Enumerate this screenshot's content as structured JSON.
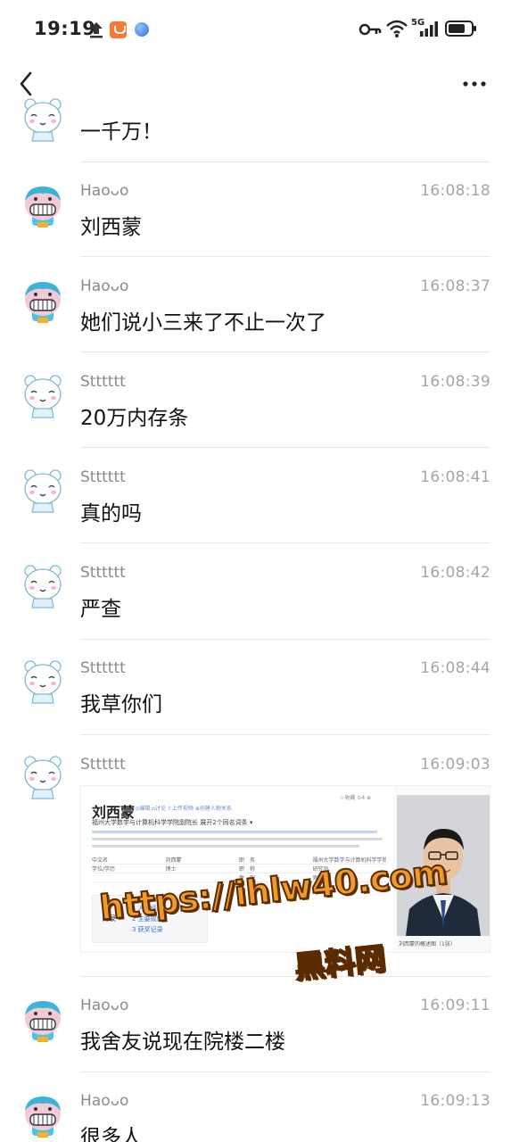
{
  "status_bar": {
    "time": "19:19",
    "network": "5G",
    "icons": [
      "upload-icon",
      "shield-app-icon",
      "globe-app-icon",
      "key-icon",
      "wifi-icon",
      "signal-icon",
      "battery-icon"
    ]
  },
  "nav": {
    "back_icon": "chevron-left-icon",
    "more_icon": "more-dots-icon"
  },
  "messages": [
    {
      "sender": "",
      "time": "",
      "text": "一千万！",
      "avatar": "emoji-avatar-b"
    },
    {
      "sender": "Haoᴗo",
      "time": "16:08:18",
      "text": "刘西蒙",
      "avatar": "emoji-avatar-a"
    },
    {
      "sender": "Haoᴗo",
      "time": "16:08:37",
      "text": "她们说小三来了不止一次了",
      "avatar": "emoji-avatar-a"
    },
    {
      "sender": "Stttttt",
      "time": "16:08:39",
      "text": "20万内存条",
      "avatar": "emoji-avatar-b"
    },
    {
      "sender": "Stttttt",
      "time": "16:08:41",
      "text": "真的吗",
      "avatar": "emoji-avatar-b"
    },
    {
      "sender": "Stttttt",
      "time": "16:08:42",
      "text": "严查",
      "avatar": "emoji-avatar-b"
    },
    {
      "sender": "Stttttt",
      "time": "16:08:44",
      "text": "我草你们",
      "avatar": "emoji-avatar-b"
    },
    {
      "sender": "Stttttt",
      "time": "16:09:03",
      "text": "",
      "avatar": "emoji-avatar-b"
    },
    {
      "sender": "Haoᴗo",
      "time": "16:09:11",
      "text": "我舍友说现在院楼二楼",
      "avatar": "emoji-avatar-a"
    },
    {
      "sender": "Haoᴗo",
      "time": "16:09:13",
      "text": "很多人",
      "avatar": "emoji-avatar-a"
    }
  ],
  "image_message": {
    "title": "刘西蒙",
    "tools": "◎编辑  ⌂讨论  ⇪上传视频  ⊕创建人物关系",
    "right_tools": "☆收藏  ⊙4  ⊕",
    "subtitle": "福州大学数学与计算机科学学院副院长  展开2个同名词条 ▾",
    "table_rows": [
      [
        "中文名",
        "刘西蒙",
        "职　务",
        "福州大学数学与计算机科学学院副院长"
      ],
      [
        "学位/学历",
        "博士",
        "职　称",
        "研究员"
      ],
      [
        "",
        "",
        "性　别",
        "男"
      ]
    ],
    "toc_label": "目录",
    "toc_items": [
      "1  人物经历",
      "2  主要成就",
      "3  获奖记录"
    ],
    "photo_caption": "刘西蒙的概述图（1张）",
    "watermark_url": "https://ihlw40.com",
    "watermark_cn": "黑料网"
  }
}
